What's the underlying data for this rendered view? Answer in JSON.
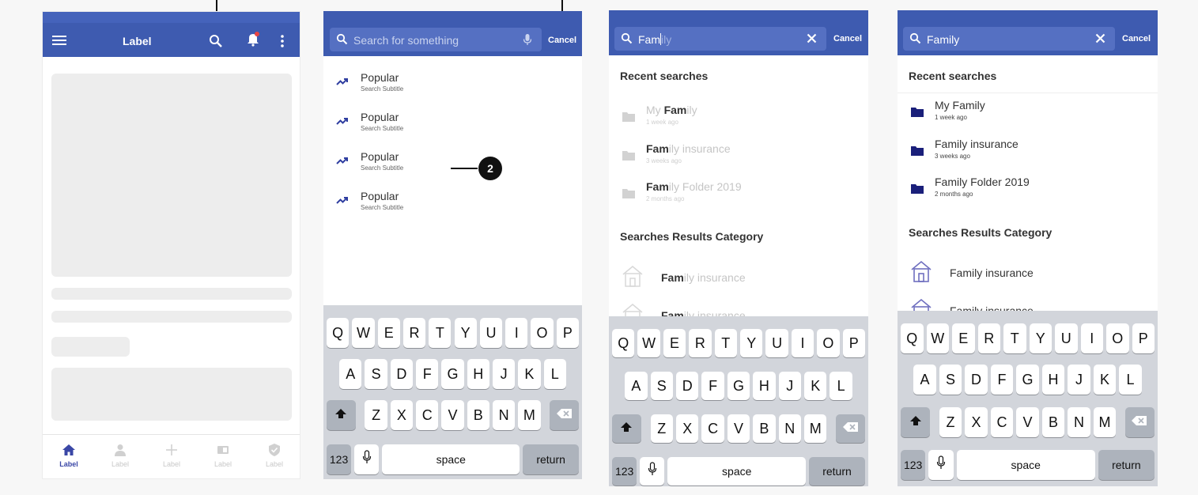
{
  "screen1": {
    "title": "Label",
    "icons": [
      "menu-icon",
      "search-icon",
      "bell-icon",
      "more-vert-icon"
    ],
    "tabs": [
      {
        "label": "Label",
        "icon": "home-icon",
        "active": true
      },
      {
        "label": "Label",
        "icon": "person-icon",
        "active": false
      },
      {
        "label": "Label",
        "icon": "plus-icon",
        "active": false
      },
      {
        "label": "Label",
        "icon": "card-icon",
        "active": false
      },
      {
        "label": "Label",
        "icon": "shield-icon",
        "active": false
      }
    ]
  },
  "screen2": {
    "search_placeholder": "Search for something",
    "cancel_label": "Cancel",
    "popular": [
      {
        "title": "Popular",
        "subtitle": "Search Subtitle"
      },
      {
        "title": "Popular",
        "subtitle": "Search Subtitle"
      },
      {
        "title": "Popular",
        "subtitle": "Search Subtitle"
      },
      {
        "title": "Popular",
        "subtitle": "Search Subtitle"
      }
    ],
    "callout_number": "2"
  },
  "screen3": {
    "search_typed": "Fam",
    "search_suggest": "ily",
    "cancel_label": "Cancel",
    "recent_heading": "Recent searches",
    "recent": [
      {
        "prefix": "My ",
        "match": "Fam",
        "rest": "ily",
        "time": "1 week ago"
      },
      {
        "prefix": "",
        "match": "Fam",
        "rest": "ily insurance",
        "time": "3 weeks ago"
      },
      {
        "prefix": "",
        "match": "Fam",
        "rest": "ily Folder 2019",
        "time": "2 months ago"
      }
    ],
    "category_heading": "Searches Results Category",
    "categories": [
      {
        "match": "Fam",
        "rest": "ily insurance"
      },
      {
        "match": "Fam",
        "rest": "ily insurance"
      }
    ]
  },
  "screen4": {
    "search_value": "Family",
    "cancel_label": "Cancel",
    "recent_heading": "Recent searches",
    "recent": [
      {
        "title": "My Family",
        "time": "1 week ago"
      },
      {
        "title": "Family insurance",
        "time": "3 weeks ago"
      },
      {
        "title": "Family Folder 2019",
        "time": "2 months ago"
      }
    ],
    "category_heading": "Searches Results Category",
    "categories": [
      {
        "title": "Family insurance"
      },
      {
        "title": "Family insurance"
      }
    ]
  },
  "keyboard": {
    "row1": [
      "Q",
      "W",
      "E",
      "R",
      "T",
      "Y",
      "U",
      "I",
      "O",
      "P"
    ],
    "row2": [
      "A",
      "S",
      "D",
      "F",
      "G",
      "H",
      "J",
      "K",
      "L"
    ],
    "row3": [
      "Z",
      "X",
      "C",
      "V",
      "B",
      "N",
      "M"
    ],
    "numbers_label": "123",
    "space_label": "space",
    "return_label": "return"
  },
  "colors": {
    "bar": "#3e5bb0",
    "field": "#5570c2",
    "accent": "#3a47a6",
    "keyboard_bg": "#d2d5db"
  }
}
